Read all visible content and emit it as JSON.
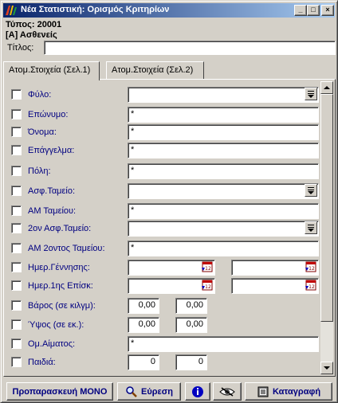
{
  "window": {
    "title": "Νέα Στατιστική: Ορισμός Κριτηρίων",
    "minimize_glyph": "_",
    "maximize_glyph": "□",
    "close_glyph": "×"
  },
  "header": {
    "type_line": "Τύπος: 20001",
    "category_line": "[Α] Ασθενείς",
    "title_label": "Τίτλος:",
    "title_value": ""
  },
  "tabs": [
    {
      "label": "Ατομ.Στοιχεία (Σελ.1)",
      "active": true
    },
    {
      "label": "Ατομ.Στοιχεία (Σελ.2)",
      "active": false
    }
  ],
  "fields": [
    {
      "label": "Φύλο:",
      "type": "dropdown",
      "value": ""
    },
    {
      "label": "Επώνυμο:",
      "type": "text",
      "value": "*"
    },
    {
      "label": "Όνομα:",
      "type": "text",
      "value": "*"
    },
    {
      "label": "Επάγγελμα:",
      "type": "text",
      "value": "*"
    },
    {
      "label": "Πόλη:",
      "type": "text",
      "value": "*"
    },
    {
      "label": "Ασφ.Ταμείο:",
      "type": "dropdown",
      "value": ""
    },
    {
      "label": "ΑΜ Ταμείου:",
      "type": "text",
      "value": "*"
    },
    {
      "label": "2ον Ασφ.Ταμείο:",
      "type": "dropdown",
      "value": ""
    },
    {
      "label": "ΑΜ 2οντος Ταμείου:",
      "type": "text",
      "value": "*"
    },
    {
      "label": "Ημερ.Γέννησης:",
      "type": "daterange",
      "from": "",
      "to": ""
    },
    {
      "label": "Ημερ.1ης Επίσκ:",
      "type": "daterange",
      "from": "",
      "to": ""
    },
    {
      "label": "Βάρος (σε κιλγμ):",
      "type": "numrange",
      "from": "0,00",
      "to": "0,00"
    },
    {
      "label": "Ύψος (σε εκ.):",
      "type": "numrange",
      "from": "0,00",
      "to": "0,00"
    },
    {
      "label": "Ομ.Αίματος:",
      "type": "text",
      "value": "*"
    },
    {
      "label": "Παιδιά:",
      "type": "intrange",
      "from": "0",
      "to": "0"
    }
  ],
  "buttons": {
    "preprocess": "Προπαρασκευή ΜΟΝΟ",
    "search": "Εύρεση",
    "save": "Καταγραφή"
  },
  "icons": {
    "dropdown": "dropdown-arrow-icon",
    "calendar": "calendar-icon",
    "info": "info-icon",
    "preview": "eye-icon",
    "search": "magnifier-icon",
    "save": "record-book-icon"
  },
  "colors": {
    "titlebar_start": "#0a246a",
    "titlebar_end": "#a6caf0",
    "label_text": "#000080",
    "face": "#d4d0c8"
  }
}
